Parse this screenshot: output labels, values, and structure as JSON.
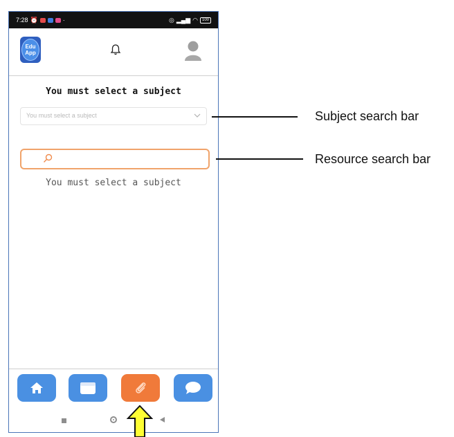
{
  "status_bar": {
    "time": "7:28",
    "battery": "100"
  },
  "app": {
    "logo_line1": "Edu",
    "logo_line2": "App"
  },
  "main": {
    "title": "You must select a subject",
    "subject_select": {
      "placeholder": "You must select a subject"
    },
    "resource_search": {
      "value": "",
      "placeholder": ""
    },
    "message": "You must select a subject"
  },
  "bottom_nav": [
    {
      "icon": "home-icon",
      "color": "#4a90e2"
    },
    {
      "icon": "calendar-icon",
      "color": "#4a90e2"
    },
    {
      "icon": "paperclip-icon",
      "color": "#f07a3a",
      "active": true
    },
    {
      "icon": "chat-bubble-icon",
      "color": "#4a90e2"
    }
  ],
  "annotations": {
    "subject_label": "Subject search bar",
    "resource_label": "Resource search bar"
  }
}
